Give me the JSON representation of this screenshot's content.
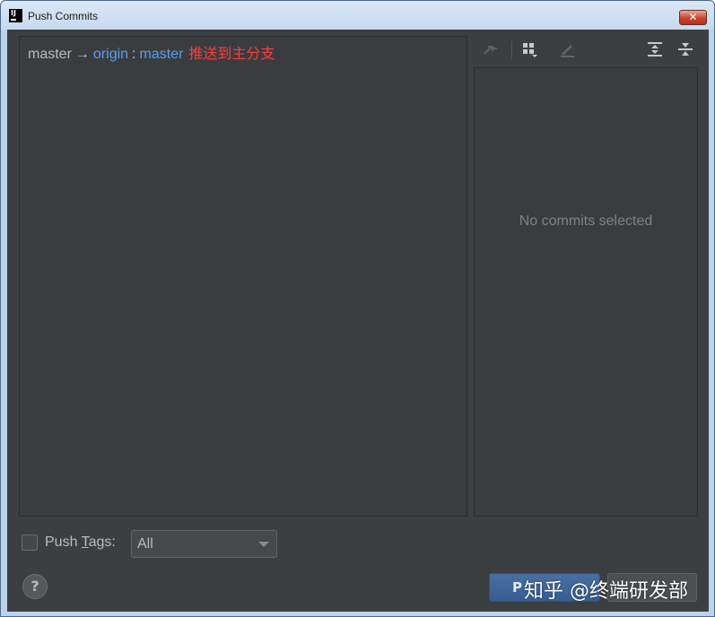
{
  "window": {
    "title": "Push Commits",
    "close_glyph": "✕",
    "app_icon_text": "IJ"
  },
  "push_spec": {
    "source_branch": "master",
    "arrow": "→",
    "remote": "origin",
    "separator": ":",
    "target_branch": "master",
    "annotation": "推送到主分支"
  },
  "toolbar": {
    "icons": [
      "cherry-pick-icon",
      "group-by-icon",
      "edit-icon",
      "expand-all-icon",
      "collapse-all-icon"
    ]
  },
  "details": {
    "empty_text": "No commits selected"
  },
  "push_tags": {
    "checked": false,
    "label_prefix": "Push ",
    "label_mnemonic": "T",
    "label_suffix": "ags:",
    "selected_option": "All"
  },
  "buttons": {
    "help": "?",
    "push_partial": "P"
  },
  "watermark": "知乎 @终端研发部",
  "colors": {
    "background": "#3c3f41",
    "remote": "#589df6",
    "annotation": "#ff3b3b"
  }
}
